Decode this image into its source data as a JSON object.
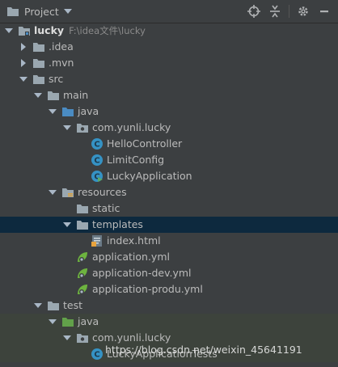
{
  "header": {
    "title": "Project",
    "colors": {
      "bg": "#3c3f41",
      "selection": "#0d293e",
      "test_bg": "#3d433c"
    }
  },
  "tree": {
    "root_name": "lucky",
    "root_path": "F:\\idea文件\\lucky",
    "idea": ".idea",
    "mvn": ".mvn",
    "src": "src",
    "main": "main",
    "main_java": "java",
    "main_pkg": "com.yunli.lucky",
    "hello_controller": "HelloController",
    "limit_config": "LimitConfig",
    "lucky_application": "LuckyApplication",
    "resources": "resources",
    "static": "static",
    "templates": "templates",
    "index_html": "index.html",
    "application_yml": "application.yml",
    "application_dev_yml": "application-dev.yml",
    "application_produ_yml": "application-produ.yml",
    "test": "test",
    "test_java": "java",
    "test_pkg": "com.yunli.lucky",
    "lucky_tests": "LuckyApplicationTests"
  },
  "watermark": "https://blog.csdn.net/weixin_45641191"
}
